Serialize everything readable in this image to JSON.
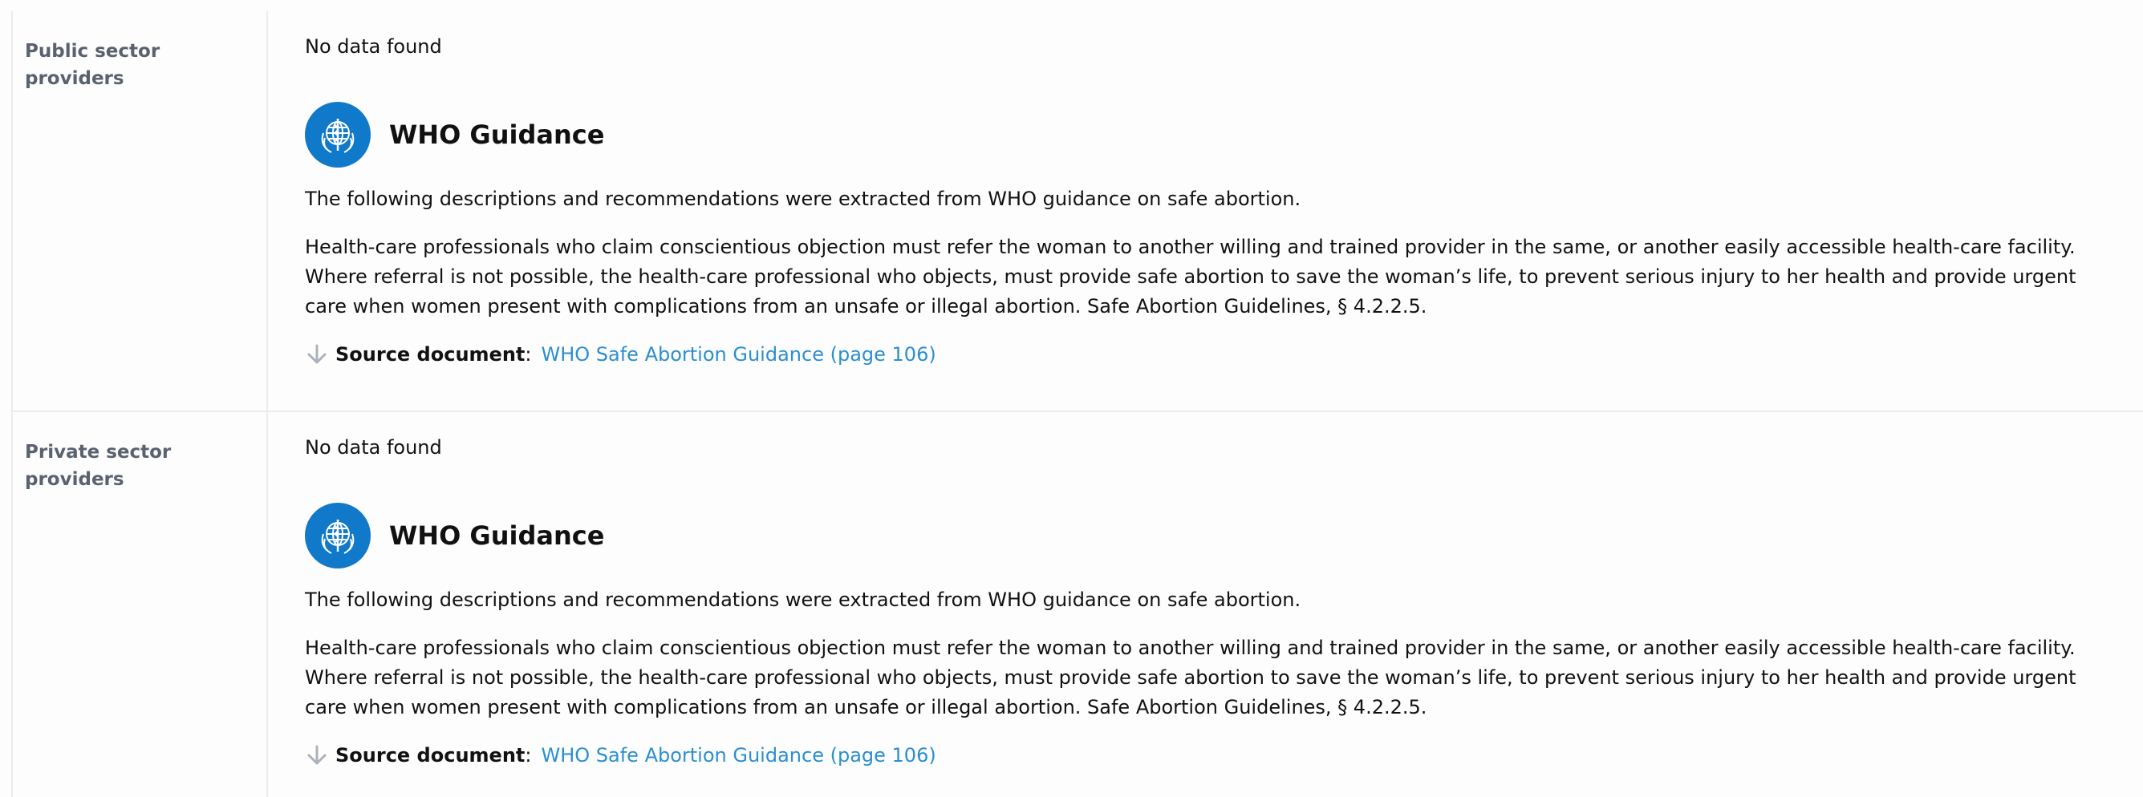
{
  "rows": [
    {
      "label": "Public sector providers",
      "no_data": "No data found",
      "guidance": {
        "title": "WHO Guidance",
        "intro": "The following descriptions and recommendations were extracted from WHO guidance on safe abortion.",
        "body": "Health-care professionals who claim conscientious objection must refer the woman to another willing and trained provider in the same, or another easily accessible health-care facility. Where referral is not possible, the health-care professional who objects, must provide safe abortion to save the woman’s life, to prevent serious injury to her health and provide urgent care when women present with complications from an unsafe or illegal abortion. Safe Abortion Guidelines, § 4.2.2.5.",
        "source_label": "Source document",
        "source_sep": ":",
        "source_link": "WHO Safe Abortion Guidance (page 106)"
      }
    },
    {
      "label": "Private sector providers",
      "no_data": "No data found",
      "guidance": {
        "title": "WHO Guidance",
        "intro": "The following descriptions and recommendations were extracted from WHO guidance on safe abortion.",
        "body": "Health-care professionals who claim conscientious objection must refer the woman to another willing and trained provider in the same, or another easily accessible health-care facility. Where referral is not possible, the health-care professional who objects, must provide safe abortion to save the woman’s life, to prevent serious injury to her health and provide urgent care when women present with complications from an unsafe or illegal abortion. Safe Abortion Guidelines, § 4.2.2.5.",
        "source_label": "Source document",
        "source_sep": ":",
        "source_link": "WHO Safe Abortion Guidance (page 106)"
      }
    }
  ],
  "icons": {
    "logo": "who-emblem-icon",
    "arrow": "arrow-down-icon"
  },
  "colors": {
    "who_blue": "#1079c9",
    "link": "#2b8fd0",
    "label": "#5a6270",
    "divider": "#ececec"
  }
}
